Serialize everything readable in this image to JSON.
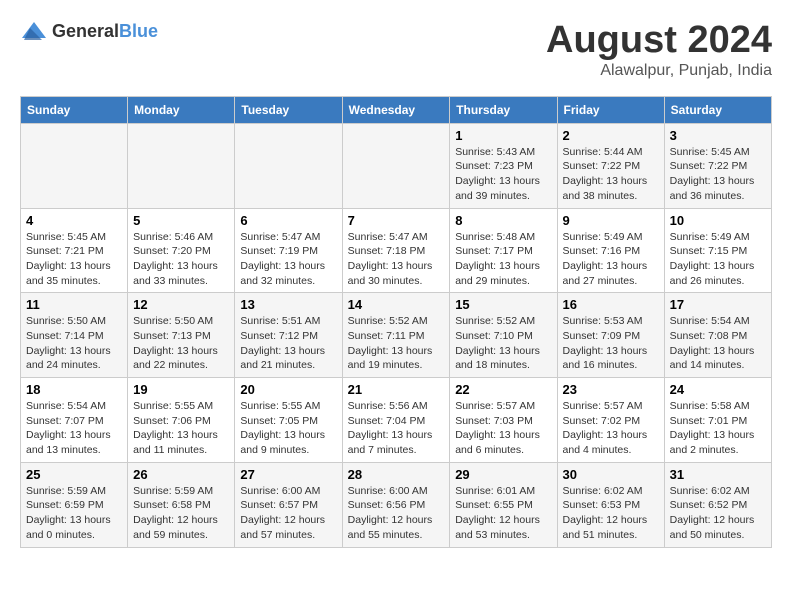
{
  "header": {
    "logo_general": "General",
    "logo_blue": "Blue",
    "month_year": "August 2024",
    "location": "Alawalpur, Punjab, India"
  },
  "weekdays": [
    "Sunday",
    "Monday",
    "Tuesday",
    "Wednesday",
    "Thursday",
    "Friday",
    "Saturday"
  ],
  "weeks": [
    [
      {
        "day": "",
        "info": ""
      },
      {
        "day": "",
        "info": ""
      },
      {
        "day": "",
        "info": ""
      },
      {
        "day": "",
        "info": ""
      },
      {
        "day": "1",
        "info": "Sunrise: 5:43 AM\nSunset: 7:23 PM\nDaylight: 13 hours\nand 39 minutes."
      },
      {
        "day": "2",
        "info": "Sunrise: 5:44 AM\nSunset: 7:22 PM\nDaylight: 13 hours\nand 38 minutes."
      },
      {
        "day": "3",
        "info": "Sunrise: 5:45 AM\nSunset: 7:22 PM\nDaylight: 13 hours\nand 36 minutes."
      }
    ],
    [
      {
        "day": "4",
        "info": "Sunrise: 5:45 AM\nSunset: 7:21 PM\nDaylight: 13 hours\nand 35 minutes."
      },
      {
        "day": "5",
        "info": "Sunrise: 5:46 AM\nSunset: 7:20 PM\nDaylight: 13 hours\nand 33 minutes."
      },
      {
        "day": "6",
        "info": "Sunrise: 5:47 AM\nSunset: 7:19 PM\nDaylight: 13 hours\nand 32 minutes."
      },
      {
        "day": "7",
        "info": "Sunrise: 5:47 AM\nSunset: 7:18 PM\nDaylight: 13 hours\nand 30 minutes."
      },
      {
        "day": "8",
        "info": "Sunrise: 5:48 AM\nSunset: 7:17 PM\nDaylight: 13 hours\nand 29 minutes."
      },
      {
        "day": "9",
        "info": "Sunrise: 5:49 AM\nSunset: 7:16 PM\nDaylight: 13 hours\nand 27 minutes."
      },
      {
        "day": "10",
        "info": "Sunrise: 5:49 AM\nSunset: 7:15 PM\nDaylight: 13 hours\nand 26 minutes."
      }
    ],
    [
      {
        "day": "11",
        "info": "Sunrise: 5:50 AM\nSunset: 7:14 PM\nDaylight: 13 hours\nand 24 minutes."
      },
      {
        "day": "12",
        "info": "Sunrise: 5:50 AM\nSunset: 7:13 PM\nDaylight: 13 hours\nand 22 minutes."
      },
      {
        "day": "13",
        "info": "Sunrise: 5:51 AM\nSunset: 7:12 PM\nDaylight: 13 hours\nand 21 minutes."
      },
      {
        "day": "14",
        "info": "Sunrise: 5:52 AM\nSunset: 7:11 PM\nDaylight: 13 hours\nand 19 minutes."
      },
      {
        "day": "15",
        "info": "Sunrise: 5:52 AM\nSunset: 7:10 PM\nDaylight: 13 hours\nand 18 minutes."
      },
      {
        "day": "16",
        "info": "Sunrise: 5:53 AM\nSunset: 7:09 PM\nDaylight: 13 hours\nand 16 minutes."
      },
      {
        "day": "17",
        "info": "Sunrise: 5:54 AM\nSunset: 7:08 PM\nDaylight: 13 hours\nand 14 minutes."
      }
    ],
    [
      {
        "day": "18",
        "info": "Sunrise: 5:54 AM\nSunset: 7:07 PM\nDaylight: 13 hours\nand 13 minutes."
      },
      {
        "day": "19",
        "info": "Sunrise: 5:55 AM\nSunset: 7:06 PM\nDaylight: 13 hours\nand 11 minutes."
      },
      {
        "day": "20",
        "info": "Sunrise: 5:55 AM\nSunset: 7:05 PM\nDaylight: 13 hours\nand 9 minutes."
      },
      {
        "day": "21",
        "info": "Sunrise: 5:56 AM\nSunset: 7:04 PM\nDaylight: 13 hours\nand 7 minutes."
      },
      {
        "day": "22",
        "info": "Sunrise: 5:57 AM\nSunset: 7:03 PM\nDaylight: 13 hours\nand 6 minutes."
      },
      {
        "day": "23",
        "info": "Sunrise: 5:57 AM\nSunset: 7:02 PM\nDaylight: 13 hours\nand 4 minutes."
      },
      {
        "day": "24",
        "info": "Sunrise: 5:58 AM\nSunset: 7:01 PM\nDaylight: 13 hours\nand 2 minutes."
      }
    ],
    [
      {
        "day": "25",
        "info": "Sunrise: 5:59 AM\nSunset: 6:59 PM\nDaylight: 13 hours\nand 0 minutes."
      },
      {
        "day": "26",
        "info": "Sunrise: 5:59 AM\nSunset: 6:58 PM\nDaylight: 12 hours\nand 59 minutes."
      },
      {
        "day": "27",
        "info": "Sunrise: 6:00 AM\nSunset: 6:57 PM\nDaylight: 12 hours\nand 57 minutes."
      },
      {
        "day": "28",
        "info": "Sunrise: 6:00 AM\nSunset: 6:56 PM\nDaylight: 12 hours\nand 55 minutes."
      },
      {
        "day": "29",
        "info": "Sunrise: 6:01 AM\nSunset: 6:55 PM\nDaylight: 12 hours\nand 53 minutes."
      },
      {
        "day": "30",
        "info": "Sunrise: 6:02 AM\nSunset: 6:53 PM\nDaylight: 12 hours\nand 51 minutes."
      },
      {
        "day": "31",
        "info": "Sunrise: 6:02 AM\nSunset: 6:52 PM\nDaylight: 12 hours\nand 50 minutes."
      }
    ]
  ]
}
